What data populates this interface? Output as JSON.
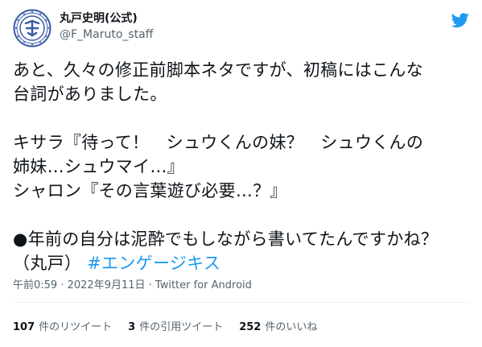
{
  "author": {
    "display_name": "丸戸史明(公式)",
    "handle": "@F_Maruto_staff"
  },
  "tweet": {
    "lines": [
      "あと、久々の修正前脚本ネタですが、初稿にはこんな",
      "台詞がありました。",
      "",
      "キサラ『待って！　シュウくんの妹？　シュウくんの",
      "姉妹…シュウマイ…』",
      "シャロン『その言葉遊び必要…？』",
      "",
      "●年前の自分は泥酔でもしながら書いてたんですかね？"
    ],
    "last_line_prefix": "（丸戸）",
    "hashtag": "#エンゲージキス"
  },
  "meta": {
    "time": "午前0:59",
    "separator": " · ",
    "date": "2022年9月11日",
    "source": "Twitter for Android"
  },
  "stats": {
    "retweets_count": "107",
    "retweets_label": "件のリツイート",
    "quotes_count": "3",
    "quotes_label": "件の引用ツイート",
    "likes_count": "252",
    "likes_label": "件のいいね"
  },
  "colors": {
    "accent": "#1d9bf0",
    "text": "#0f1419",
    "secondary": "#536471",
    "avatar_blue": "#3a5aa8"
  },
  "icons": {
    "avatar": "round-blue-emblem",
    "more": "more-icon",
    "logo": "twitter-logo-icon"
  }
}
